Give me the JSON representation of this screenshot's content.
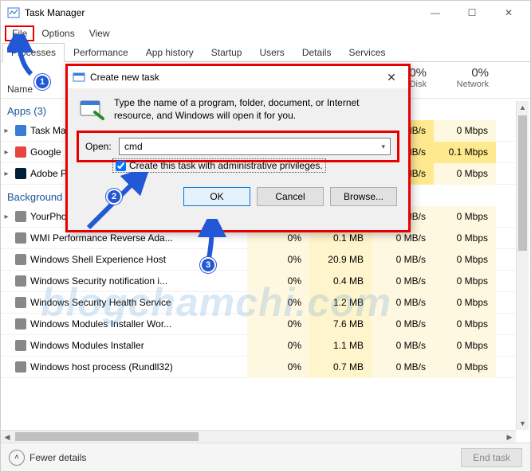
{
  "window": {
    "title": "Task Manager",
    "min": "—",
    "max": "☐",
    "close": "✕"
  },
  "menu": [
    "File",
    "Options",
    "View"
  ],
  "tabs": [
    "Processes",
    "Performance",
    "App history",
    "Startup",
    "Users",
    "Details",
    "Services"
  ],
  "active_tab": 0,
  "columns": {
    "name": "Name",
    "metrics": [
      {
        "pct": "",
        "label": ""
      },
      {
        "pct": "",
        "label": ""
      },
      {
        "pct": "0%",
        "label": "Disk"
      },
      {
        "pct": "0%",
        "label": "Network"
      }
    ]
  },
  "sections": {
    "apps": {
      "label": "Apps (3)",
      "rows": [
        {
          "name": "Task Manager",
          "expander": true,
          "cells": [
            "",
            "",
            "0.1 MB/s",
            "0 Mbps"
          ],
          "hot": [
            "disk"
          ]
        },
        {
          "name": "Google",
          "expander": true,
          "cells": [
            "",
            "",
            "0.1 MB/s",
            "0.1 Mbps"
          ],
          "hot": [
            "disk",
            "net"
          ]
        },
        {
          "name": "Adobe Photoshop",
          "expander": true,
          "cells": [
            "",
            "",
            "0.1 MB/s",
            "0 Mbps"
          ],
          "hot": [
            "disk"
          ]
        }
      ]
    },
    "bg": {
      "label": "Background processes",
      "rows": [
        {
          "name": "YourPhone",
          "expander": true,
          "cells": [
            "",
            "",
            "0 MB/s",
            "0 Mbps"
          ]
        },
        {
          "name": "WMI Performance Reverse Ada...",
          "cells": [
            "0%",
            "0.1 MB",
            "0 MB/s",
            "0 Mbps"
          ]
        },
        {
          "name": "Windows Shell Experience Host",
          "cells": [
            "0%",
            "20.9 MB",
            "0 MB/s",
            "0 Mbps"
          ]
        },
        {
          "name": "Windows Security notification i...",
          "cells": [
            "0%",
            "0.4 MB",
            "0 MB/s",
            "0 Mbps"
          ]
        },
        {
          "name": "Windows Security Health Service",
          "cells": [
            "0%",
            "1.2 MB",
            "0 MB/s",
            "0 Mbps"
          ]
        },
        {
          "name": "Windows Modules Installer Wor...",
          "cells": [
            "0%",
            "7.6 MB",
            "0 MB/s",
            "0 Mbps"
          ]
        },
        {
          "name": "Windows Modules Installer",
          "cells": [
            "0%",
            "1.1 MB",
            "0 MB/s",
            "0 Mbps"
          ]
        },
        {
          "name": "Windows host process (Rundll32)",
          "cells": [
            "0%",
            "0.7 MB",
            "0 MB/s",
            "0 Mbps"
          ]
        }
      ]
    }
  },
  "status": {
    "fewer": "Fewer details",
    "endtask": "End task"
  },
  "dialog": {
    "title": "Create new task",
    "message": "Type the name of a program, folder, document, or Internet resource, and Windows will open it for you.",
    "open_label": "Open:",
    "open_value": "cmd",
    "admin_label": "Create this task with administrative privileges.",
    "admin_checked": true,
    "ok": "OK",
    "cancel": "Cancel",
    "browse": "Browse..."
  },
  "annotations": {
    "n1": "1",
    "n2": "2",
    "n3": "3"
  },
  "watermark": "blogchamchi.com"
}
